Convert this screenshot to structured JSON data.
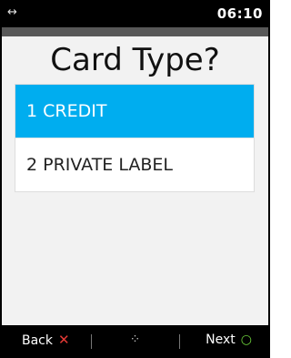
{
  "status_bar": {
    "time": "06:10",
    "icon": "swap-arrows-icon"
  },
  "screen": {
    "title": "Card Type?",
    "options": [
      {
        "label": "1 CREDIT",
        "selected": true
      },
      {
        "label": "2 PRIVATE LABEL",
        "selected": false
      }
    ]
  },
  "footer": {
    "back_label": "Back",
    "back_icon": "x-icon",
    "middle_icon": "move-icon",
    "next_label": "Next",
    "next_icon": "circle-icon"
  },
  "colors": {
    "accent": "#00adef",
    "back_icon": "#e53935",
    "next_icon": "#6ccf3a"
  }
}
